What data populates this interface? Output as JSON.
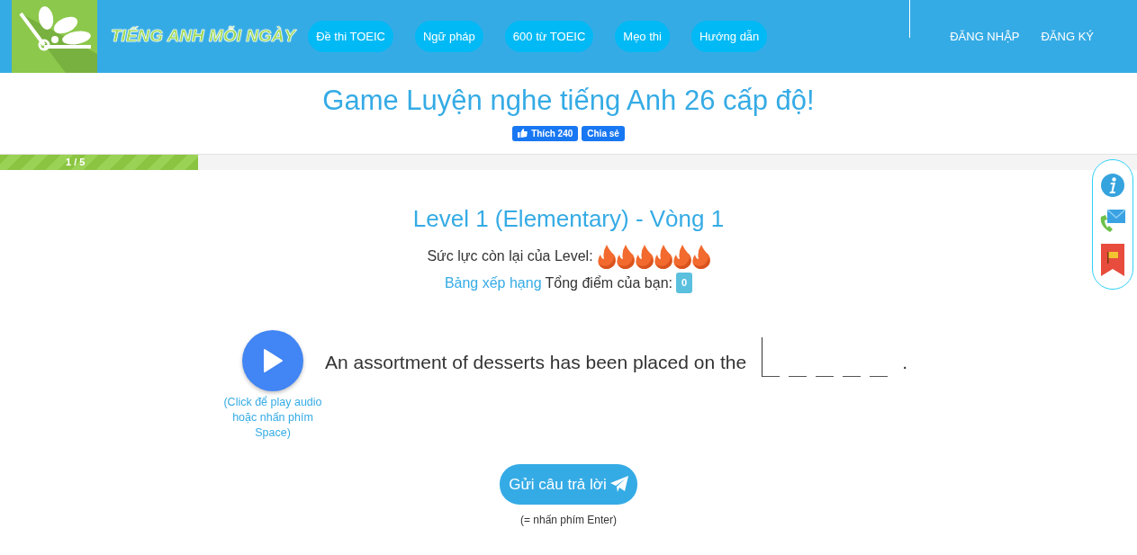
{
  "header": {
    "logo_text": "TIẾNG ANH MỖI NGÀY",
    "nav": [
      {
        "label": "Đề thi TOEIC"
      },
      {
        "label": "Ngữ pháp"
      },
      {
        "label": "600 từ TOEIC"
      },
      {
        "label": "Mẹo thi"
      },
      {
        "label": "Hướng dẫn"
      }
    ],
    "account": [
      {
        "label": "ĐĂNG NHẬP"
      },
      {
        "label": "ĐĂNG KÝ"
      }
    ]
  },
  "page_title": "Game Luyện nghe tiếng Anh 26 cấp độ!",
  "social": {
    "like": "Thích 240",
    "share": "Chia sẻ"
  },
  "progress": {
    "label": "1 / 5",
    "level": 0.174
  },
  "level_title": "Level 1 (Elementary) - Vòng 1",
  "energy": {
    "label": "Sức lực còn lại của Level:",
    "stars": 6
  },
  "score": {
    "ranking_link": "Bảng xếp hạng",
    "label": "Tổng điểm của bạn:",
    "value": "0"
  },
  "question": {
    "play_hint": "(Click để play audio hoặc nhấn phím Space)",
    "sentence": "An assortment of desserts has been placed on the",
    "end": ".",
    "blanks": [
      {
        "focused": true
      },
      {
        "focused": false
      },
      {
        "focused": false
      },
      {
        "focused": false
      },
      {
        "focused": false
      }
    ]
  },
  "submit": {
    "label": "Gửi câu trả lời",
    "hint": "(= nhấn phím Enter)"
  }
}
